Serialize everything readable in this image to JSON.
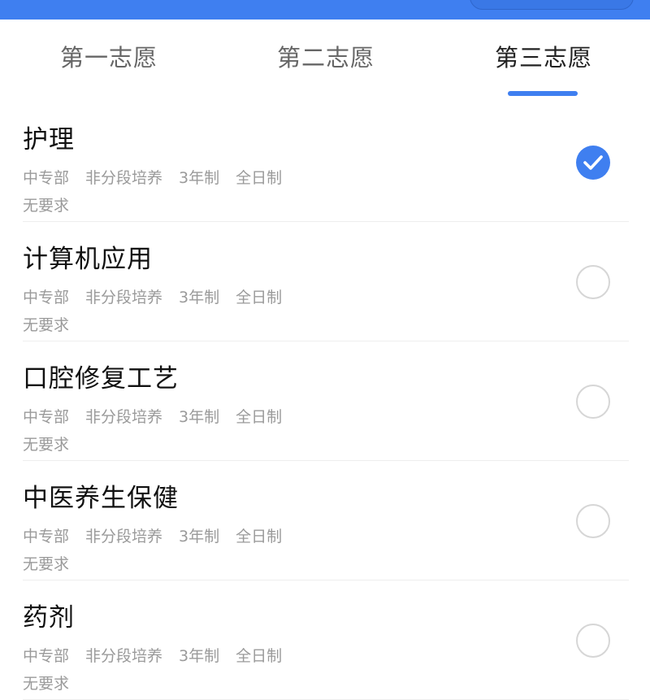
{
  "colors": {
    "accent": "#3f7ff0",
    "muted_text": "#9a9a9a",
    "title_text": "#111111",
    "divider": "#eeeeee"
  },
  "tabs": [
    {
      "label": "第一志愿",
      "active": false
    },
    {
      "label": "第二志愿",
      "active": false
    },
    {
      "label": "第三志愿",
      "active": true
    }
  ],
  "majors": [
    {
      "name": "护理",
      "department": "中专部",
      "training": "非分段培养",
      "duration": "3年制",
      "mode": "全日制",
      "requirement": "无要求",
      "selected": true
    },
    {
      "name": "计算机应用",
      "department": "中专部",
      "training": "非分段培养",
      "duration": "3年制",
      "mode": "全日制",
      "requirement": "无要求",
      "selected": false
    },
    {
      "name": "口腔修复工艺",
      "department": "中专部",
      "training": "非分段培养",
      "duration": "3年制",
      "mode": "全日制",
      "requirement": "无要求",
      "selected": false
    },
    {
      "name": "中医养生保健",
      "department": "中专部",
      "training": "非分段培养",
      "duration": "3年制",
      "mode": "全日制",
      "requirement": "无要求",
      "selected": false
    },
    {
      "name": "药剂",
      "department": "中专部",
      "training": "非分段培养",
      "duration": "3年制",
      "mode": "全日制",
      "requirement": "无要求",
      "selected": false
    }
  ]
}
